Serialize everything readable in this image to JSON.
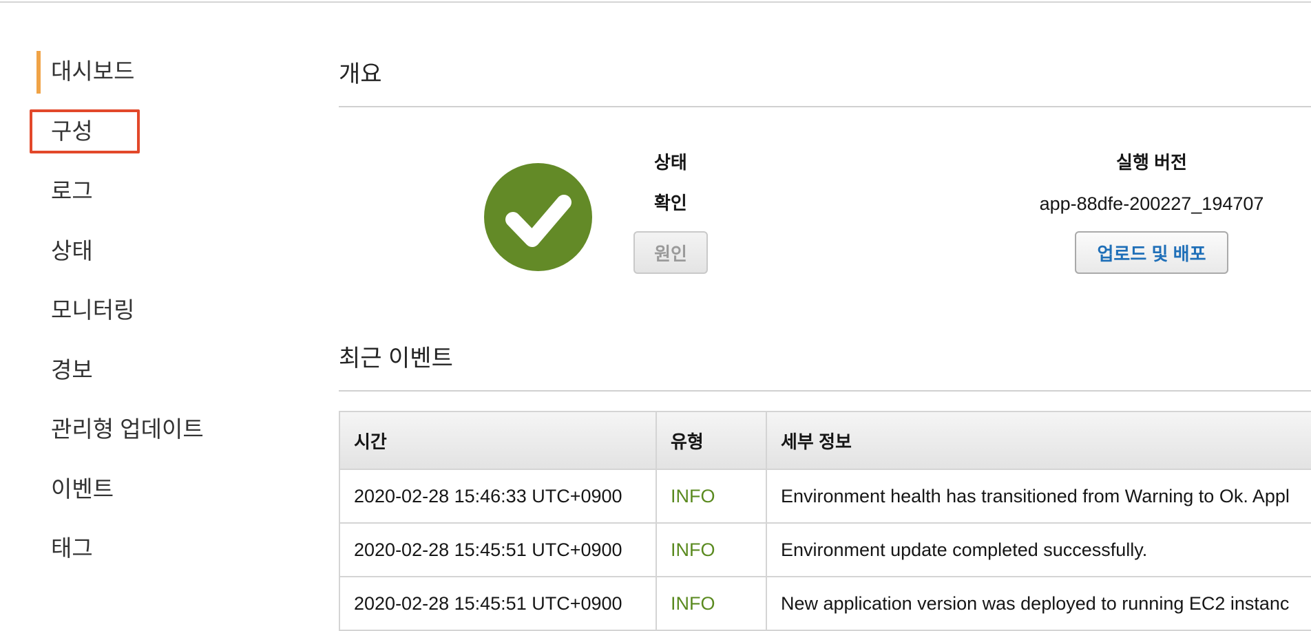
{
  "sidebar": {
    "items": [
      {
        "label": "대시보드"
      },
      {
        "label": "구성"
      },
      {
        "label": "로그"
      },
      {
        "label": "상태"
      },
      {
        "label": "모니터링"
      },
      {
        "label": "경보"
      },
      {
        "label": "관리형 업데이트"
      },
      {
        "label": "이벤트"
      },
      {
        "label": "태그"
      }
    ],
    "active_index": 0,
    "highlighted_index": 1
  },
  "overview": {
    "title": "개요",
    "health_label": "상태",
    "health_value": "확인",
    "causes_button": "원인",
    "version_label": "실행 버전",
    "version_value": "app-88dfe-200227_194707",
    "upload_button": "업로드 및 배포",
    "health_icon": "check-circle-icon",
    "health_color": "#638a27"
  },
  "events": {
    "title": "최근 이벤트",
    "columns": [
      "시간",
      "유형",
      "세부 정보"
    ],
    "rows": [
      {
        "time": "2020-02-28 15:46:33 UTC+0900",
        "type": "INFO",
        "details": "Environment health has transitioned from Warning to Ok. Appl"
      },
      {
        "time": "2020-02-28 15:45:51 UTC+0900",
        "type": "INFO",
        "details": "Environment update completed successfully."
      },
      {
        "time": "2020-02-28 15:45:51 UTC+0900",
        "type": "INFO",
        "details": "New application version was deployed to running EC2 instanc"
      }
    ]
  },
  "colors": {
    "active_accent": "#f0a346",
    "highlight_border": "#e2482a",
    "info_text": "#5a8a1f",
    "primary_button_text": "#1f6fb8"
  }
}
